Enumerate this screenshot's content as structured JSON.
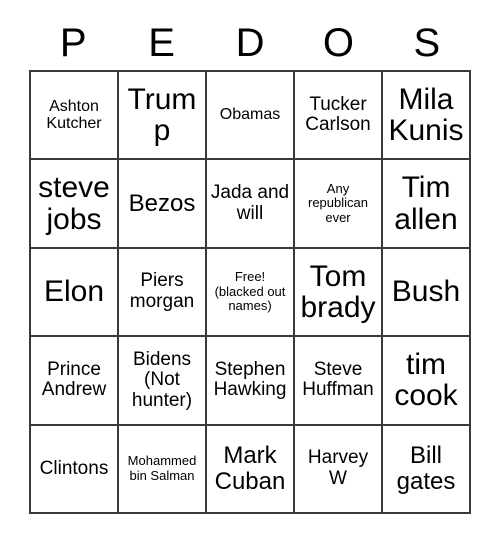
{
  "card": {
    "header_letters": [
      "P",
      "E",
      "D",
      "O",
      "S"
    ],
    "rows": [
      [
        {
          "text": "Ashton Kutcher",
          "size": "sm"
        },
        {
          "text": "Trump",
          "size": "xl"
        },
        {
          "text": "Obamas",
          "size": "sm"
        },
        {
          "text": "Tucker Carlson",
          "size": "md"
        },
        {
          "text": "Mila Kunis",
          "size": "xl"
        }
      ],
      [
        {
          "text": "steve jobs",
          "size": "xl"
        },
        {
          "text": "Bezos",
          "size": "lg"
        },
        {
          "text": "Jada and will",
          "size": "md"
        },
        {
          "text": "Any republican ever",
          "size": "xs"
        },
        {
          "text": "Tim allen",
          "size": "xl"
        }
      ],
      [
        {
          "text": "Elon",
          "size": "xl"
        },
        {
          "text": "Piers morgan",
          "size": "md"
        },
        {
          "text": "Free! (blacked out names)",
          "size": "xs"
        },
        {
          "text": "Tom brady",
          "size": "xl"
        },
        {
          "text": "Bush",
          "size": "xl"
        }
      ],
      [
        {
          "text": "Prince Andrew",
          "size": "md"
        },
        {
          "text": "Bidens (Not hunter)",
          "size": "md"
        },
        {
          "text": "Stephen Hawking",
          "size": "md"
        },
        {
          "text": "Steve Huffman",
          "size": "md"
        },
        {
          "text": "tim cook",
          "size": "xl"
        }
      ],
      [
        {
          "text": "Clintons",
          "size": "md"
        },
        {
          "text": "Mohammed bin Salman",
          "size": "xs"
        },
        {
          "text": "Mark Cuban",
          "size": "lg"
        },
        {
          "text": "Harvey W",
          "size": "md"
        },
        {
          "text": "Bill gates",
          "size": "lg"
        }
      ]
    ]
  },
  "colors": {
    "background": "#ffffff",
    "text": "#000000",
    "grid_line": "#3a3a3a"
  }
}
